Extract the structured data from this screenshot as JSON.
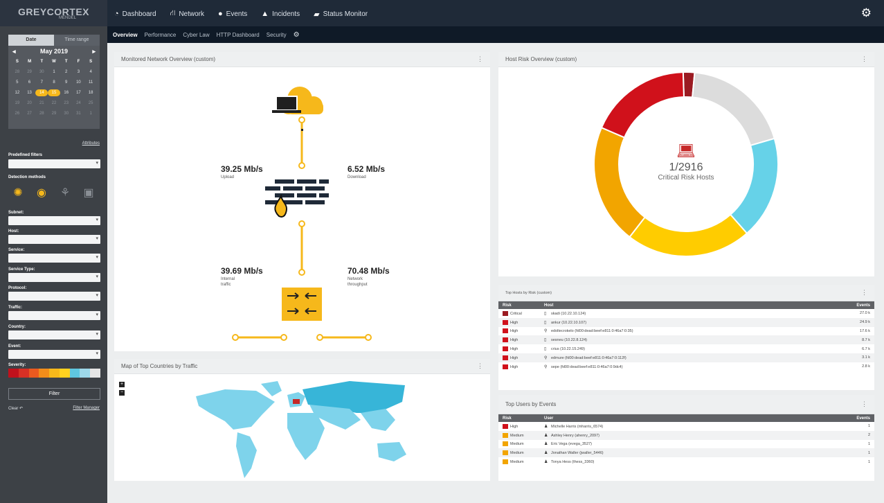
{
  "app": {
    "logo_main": "GREYCORTEX",
    "logo_sub": "MENDEL"
  },
  "nav": {
    "items": [
      {
        "label": "Dashboard",
        "icon": "dashboard-icon"
      },
      {
        "label": "Network",
        "icon": "network-icon"
      },
      {
        "label": "Events",
        "icon": "events-icon"
      },
      {
        "label": "Incidents",
        "icon": "incidents-icon"
      },
      {
        "label": "Status Monitor",
        "icon": "status-monitor-icon"
      }
    ],
    "settings_icon": "gear-icon"
  },
  "subnav": {
    "items": [
      "Overview",
      "Performance",
      "Cyber Law",
      "HTTP Dashboard",
      "Security"
    ],
    "active": "Overview"
  },
  "sidebar": {
    "tabs": [
      "Date",
      "Time range"
    ],
    "calendar": {
      "month": "May 2019",
      "weekdays": [
        "S",
        "M",
        "T",
        "W",
        "T",
        "F",
        "S"
      ],
      "rows": [
        [
          "28",
          "29",
          "30",
          "1",
          "2",
          "3",
          "4"
        ],
        [
          "5",
          "6",
          "7",
          "8",
          "9",
          "10",
          "11"
        ],
        [
          "12",
          "13",
          "14",
          "15",
          "16",
          "17",
          "18"
        ],
        [
          "19",
          "20",
          "21",
          "22",
          "23",
          "24",
          "25"
        ],
        [
          "26",
          "27",
          "28",
          "29",
          "30",
          "31",
          "1"
        ]
      ],
      "selected": [
        "14",
        "15"
      ]
    },
    "attributes_link": "Attributes",
    "predefined_filters": "Predefined filters",
    "detection_methods": "Detection methods",
    "detection_icons": [
      "brain-icon",
      "fingerprint-icon",
      "share-icon",
      "box-icon"
    ],
    "filters": [
      "Subnet:",
      "Host:",
      "Service:",
      "Service Type:",
      "Protocol:",
      "Traffic:",
      "Country:",
      "Event:"
    ],
    "severity_label": "Severity:",
    "severity_colors": [
      "#c0111c",
      "#d73025",
      "#ea5a1f",
      "#f28d1a",
      "#f6b81b",
      "#ffd21f",
      "#5fc7e0",
      "#9ed8ea",
      "#e6e6e6"
    ],
    "filter_button": "Filter",
    "clear": "Clear",
    "filter_manager": "Filter Manager"
  },
  "network_overview": {
    "title": "Monitored Network Overview (custom)",
    "upload_value": "39.25 Mb/s",
    "upload_label": "Upload",
    "download_value": "6.52 Mb/s",
    "download_label": "Download",
    "internal_value": "39.69 Mb/s",
    "internal_label_1": "Internal",
    "internal_label_2": "traffic",
    "throughput_value": "70.48 Mb/s",
    "throughput_label_1": "Network",
    "throughput_label_2": "throughput"
  },
  "host_risk": {
    "title": "Host Risk Overview (custom)",
    "center_value": "1/2916",
    "center_label": "Critical Risk Hosts",
    "center_icon": "laptop-icon",
    "segments": [
      {
        "color": "#9b1b22",
        "value": 2
      },
      {
        "color": "#dcdcdc",
        "value": 19
      },
      {
        "color": "#66d2e8",
        "value": 18
      },
      {
        "color": "#ffcc00",
        "value": 22
      },
      {
        "color": "#f2a500",
        "value": 21
      },
      {
        "color": "#d0111b",
        "value": 18
      }
    ]
  },
  "map": {
    "title": "Map of Top Countries by Traffic",
    "highlight_color": "#c62828",
    "land_color": "#7ed3eb",
    "dark_color": "#37b5d8"
  },
  "top_hosts": {
    "title": "Top Hosts by Risk (custom)",
    "columns": [
      "Risk",
      "Host",
      "Events"
    ],
    "rows": [
      {
        "risk": "Critical",
        "color": "#9b1b22",
        "icon": "computer-icon",
        "host": "skadi (10.22.10.124)",
        "events": "27.0 k"
      },
      {
        "risk": "High",
        "color": "#d0111b",
        "icon": "computer-icon",
        "host": "ankur (10.22.10.107)",
        "events": "24.9 k"
      },
      {
        "risk": "High",
        "color": "#d0111b",
        "icon": "network-device-icon",
        "host": "edoltecrokelo (fd00:dead:beef:e811:0:46a7:0:35)",
        "events": "17.6 k"
      },
      {
        "risk": "High",
        "color": "#d0111b",
        "icon": "computer-icon",
        "host": "sesneu (10.22.8.124)",
        "events": "8.7 k"
      },
      {
        "risk": "High",
        "color": "#d0111b",
        "icon": "computer-icon",
        "host": "crius (10.22.15.249)",
        "events": "6.7 k"
      },
      {
        "risk": "High",
        "color": "#d0111b",
        "icon": "network-device-icon",
        "host": "edmure (fd00:dead:beef:e811:0:46a7:0:112f)",
        "events": "3.1 k"
      },
      {
        "risk": "High",
        "color": "#d0111b",
        "icon": "network-device-icon",
        "host": "sepe (fd00:dead:beef:e811:0:46a7:0:9dc4)",
        "events": "2.8 k"
      }
    ]
  },
  "top_users": {
    "title": "Top Users by Events",
    "columns": [
      "Risk",
      "User",
      "Events"
    ],
    "rows": [
      {
        "risk": "High",
        "color": "#d0111b",
        "user": "Michelle Harris (mharris_6574)",
        "events": "1"
      },
      {
        "risk": "Medium",
        "color": "#f2a500",
        "user": "Ashley Henry (ahenry_2097)",
        "events": "2"
      },
      {
        "risk": "Medium",
        "color": "#f2a500",
        "user": "Eric Vega (evega_3527)",
        "events": "1"
      },
      {
        "risk": "Medium",
        "color": "#f2a500",
        "user": "Jonathan Waller (jwaller_5446)",
        "events": "1"
      },
      {
        "risk": "Medium",
        "color": "#f2a500",
        "user": "Tonya Hess (thess_3360)",
        "events": "1"
      }
    ]
  }
}
